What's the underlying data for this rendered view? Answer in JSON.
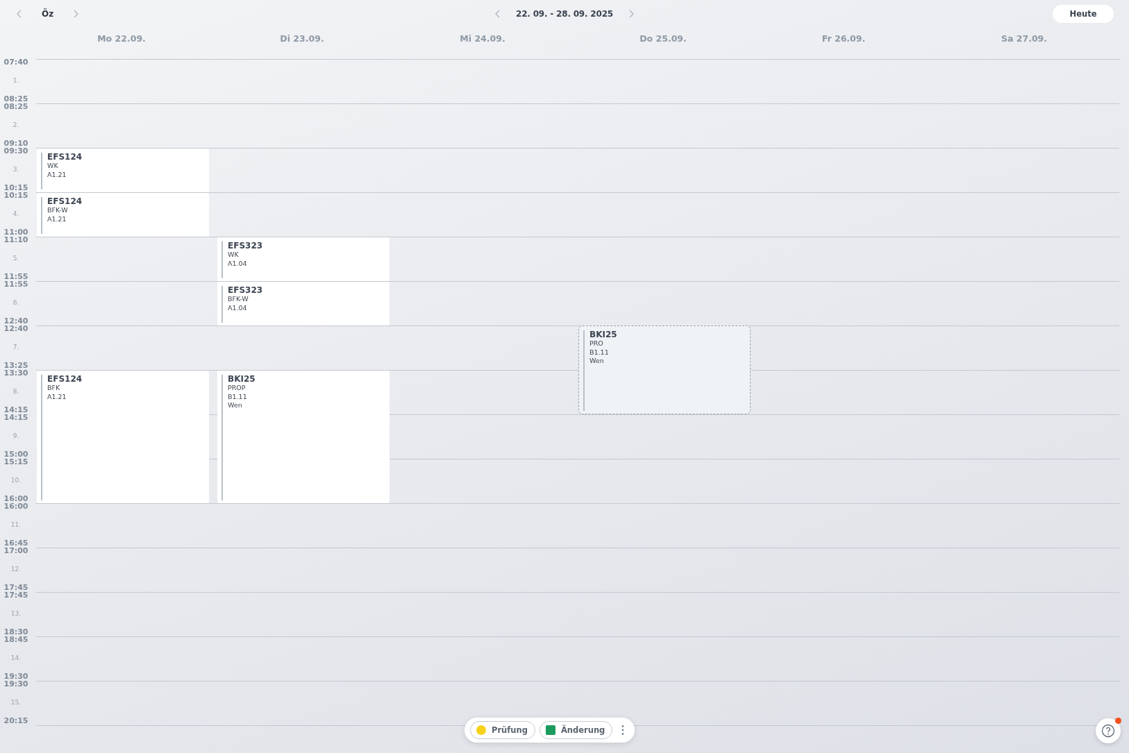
{
  "toolbar": {
    "class_name": "Öz",
    "week_range": "22. 09. - 28. 09. 2025",
    "today_button": "Heute"
  },
  "days": [
    {
      "label": "Mo 22.09.",
      "cells": [
        {
          "kind": "free"
        },
        {
          "kind": "free"
        },
        {
          "kind": "lesson",
          "subject": "EFS124",
          "lines": [
            "WK",
            "A1.21"
          ]
        },
        {
          "kind": "lesson",
          "subject": "EFS124",
          "lines": [
            "BFK-W",
            "A1.21"
          ]
        },
        {
          "kind": "free"
        },
        {
          "kind": "free"
        },
        {
          "kind": "free"
        },
        {
          "kind": "lesson",
          "subject": "EFS124",
          "lines": [
            "BFK",
            "A1.21"
          ]
        },
        {
          "kind": "continued"
        },
        {
          "kind": "continued"
        }
      ]
    },
    {
      "label": "Di 23.09.",
      "cells": [
        {
          "kind": "free"
        },
        {
          "kind": "free"
        },
        {
          "kind": "free"
        },
        {
          "kind": "free"
        },
        {
          "kind": "lesson",
          "subject": "EFS323",
          "lines": [
            "WK",
            "A1.04"
          ]
        },
        {
          "kind": "lesson",
          "subject": "EFS323",
          "lines": [
            "BFK-W",
            "A1.04"
          ]
        },
        {
          "kind": "free"
        },
        {
          "kind": "lesson",
          "subject": "BKI25",
          "lines": [
            "PROP",
            "B1.11",
            "Wen"
          ]
        },
        {
          "kind": "continued"
        },
        {
          "kind": "continued"
        }
      ]
    },
    {
      "label": "Mi 24.09."
    },
    {
      "label": "Do 25.09.",
      "cells": [
        {
          "kind": "free"
        },
        {
          "kind": "free"
        },
        {
          "kind": "free"
        },
        {
          "kind": "free"
        },
        {
          "kind": "free"
        },
        {
          "kind": "free"
        },
        {
          "kind": "outlined",
          "subject": "BKI25",
          "lines": [
            "PRO",
            "B1.11",
            "Wen"
          ]
        },
        {
          "kind": "continued"
        }
      ]
    },
    {
      "label": "Fr 26.09."
    },
    {
      "label": "Sa 27.09."
    }
  ],
  "periods": [
    {
      "number": "1.",
      "start": "07:40",
      "end": "08:25"
    },
    {
      "number": "2.",
      "start": "08:25",
      "end": "09:10"
    },
    {
      "number": "3.",
      "start": "09:30",
      "end": "10:15"
    },
    {
      "number": "4.",
      "start": "10:15",
      "end": "11:00"
    },
    {
      "number": "5.",
      "start": "11:10",
      "end": "11:55"
    },
    {
      "number": "6.",
      "start": "11:55",
      "end": "12:40"
    },
    {
      "number": "7.",
      "start": "12:40",
      "end": "13:25"
    },
    {
      "number": "8.",
      "start": "13:30",
      "end": "14:15"
    },
    {
      "number": "9.",
      "start": "14:15",
      "end": "15:00"
    },
    {
      "number": "10.",
      "start": "15:15",
      "end": "16:00"
    },
    {
      "number": "11.",
      "start": "16:00",
      "end": "16:45"
    },
    {
      "number": "12.",
      "start": "17:00",
      "end": "17:45"
    },
    {
      "number": "13.",
      "start": "17:45",
      "end": "18:30"
    },
    {
      "number": "14.",
      "start": "18:45",
      "end": "19:30"
    },
    {
      "number": "15.",
      "start": "19:30",
      "end": "20:15"
    }
  ],
  "legend": [
    {
      "label": "Prüfung",
      "kind": "dot",
      "color": "#f7d21b"
    },
    {
      "label": "Änderung",
      "kind": "square",
      "color": "#1b9a5e"
    }
  ],
  "help": {
    "has_notification": true
  }
}
